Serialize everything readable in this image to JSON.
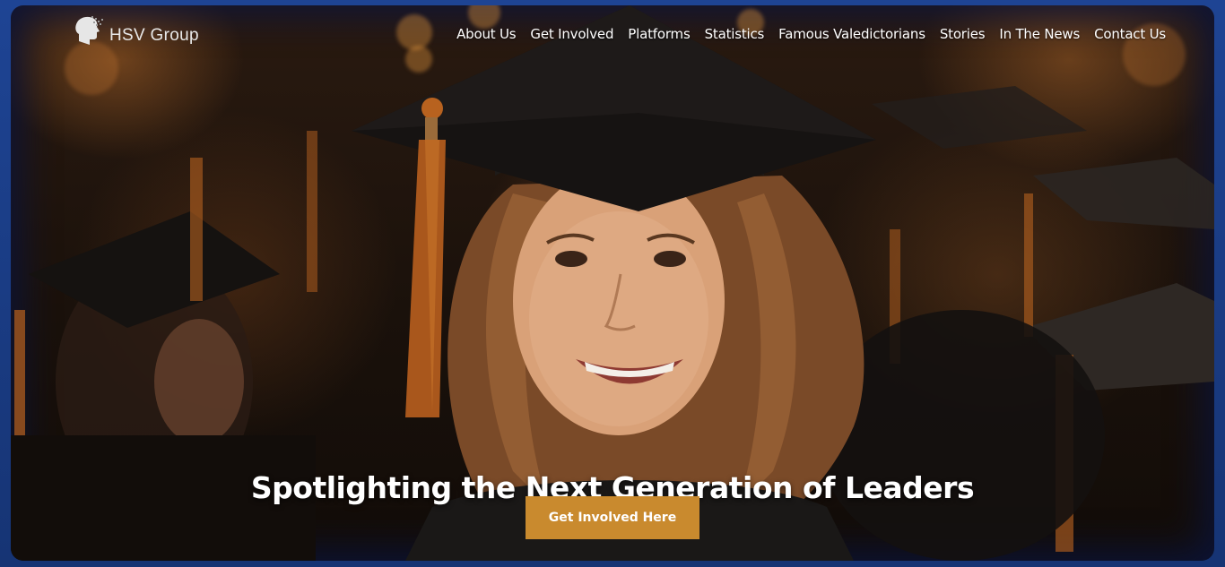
{
  "brand": {
    "name": "HSV Group",
    "logo_icon": "head-profile-icon"
  },
  "nav": {
    "items": [
      {
        "label": "About Us"
      },
      {
        "label": "Get Involved"
      },
      {
        "label": "Platforms"
      },
      {
        "label": "Statistics"
      },
      {
        "label": "Famous Valedictorians"
      },
      {
        "label": "Stories"
      },
      {
        "label": "In The News"
      },
      {
        "label": "Contact Us"
      }
    ]
  },
  "hero": {
    "headline": "Spotlighting the Next Generation of Leaders",
    "cta_label": "Get Involved Here",
    "cta_color": "#c98a2e",
    "image": "graduate-in-cap-and-gown-photo"
  }
}
